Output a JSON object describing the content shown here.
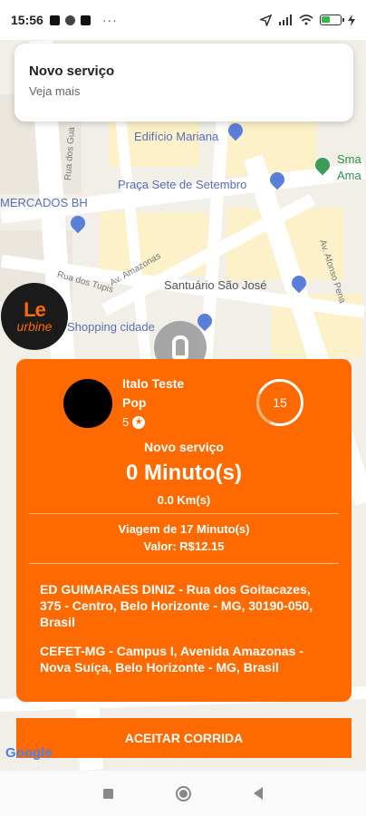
{
  "status_bar": {
    "time": "15:56",
    "more": "···",
    "battery_icon": "battery-icon",
    "wifi_icon": "wifi-icon",
    "signal_icon": "signal-icon"
  },
  "notification": {
    "title": "Novo serviço",
    "subtitle": "Veja mais"
  },
  "map": {
    "pois": [
      "Edifício Mariana",
      "Praça Sete de Setembro",
      "MERCADOS BH",
      "Santuário São José",
      "Shopping cidade",
      "Sma",
      "Ama"
    ],
    "roads": [
      "Rua dos Tupis",
      "Av. Amazonas",
      "Av. Afonso Pena",
      "Rua dos Gua"
    ],
    "google_label": "Google"
  },
  "brand": {
    "logo_top": "Le",
    "logo_bottom": "urbine"
  },
  "request": {
    "passenger_name": "Italo Teste",
    "category": "Pop",
    "rating": "5",
    "countdown": "15",
    "header": "Novo serviço",
    "minutes": "0 Minuto(s)",
    "distance": "0.0 Km(s)",
    "trip": "Viagem de  17 Minuto(s)",
    "price": "Valor: R$12.15",
    "origin": "ED GUIMARAES DINIZ - Rua dos Goitacazes, 375 - Centro, Belo Horizonte - MG, 30190-050, Brasil",
    "destination": "CEFET-MG - Campus I, Avenida Amazonas - Nova Suíça, Belo Horizonte - MG, Brasil"
  },
  "actions": {
    "accept": "ACEITAR CORRIDA"
  },
  "colors": {
    "accent": "#ff6a00"
  }
}
